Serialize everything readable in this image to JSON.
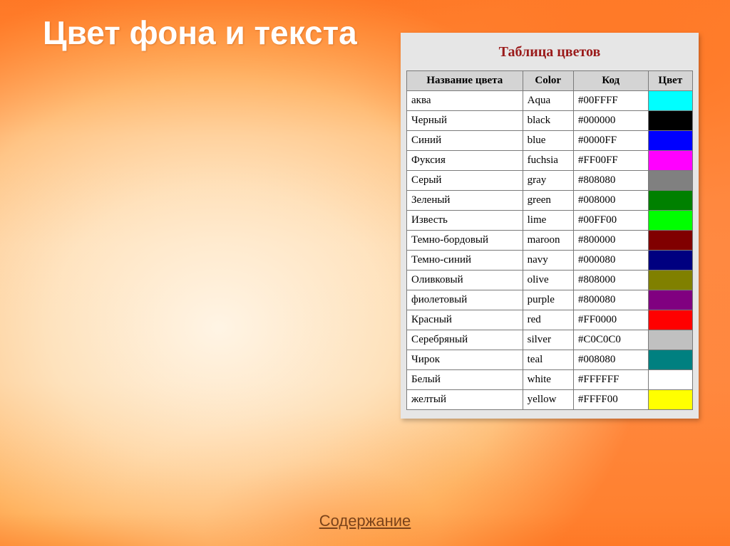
{
  "slide": {
    "title": "Цвет фона и текста"
  },
  "panel": {
    "caption": "Таблица цветов",
    "columns": {
      "name": "Название цвета",
      "en": "Color",
      "code": "Код",
      "swatch": "Цвет"
    },
    "rows": [
      {
        "name": "аква",
        "en": "Aqua",
        "code": "#00FFFF",
        "hex": "#00FFFF"
      },
      {
        "name": "Черный",
        "en": "black",
        "code": "#000000",
        "hex": "#000000"
      },
      {
        "name": "Синий",
        "en": "blue",
        "code": "#0000FF",
        "hex": "#0000FF"
      },
      {
        "name": "Фуксия",
        "en": "fuchsia",
        "code": "#FF00FF",
        "hex": "#FF00FF"
      },
      {
        "name": "Серый",
        "en": "gray",
        "code": "#808080",
        "hex": "#808080"
      },
      {
        "name": "Зеленый",
        "en": "green",
        "code": "#008000",
        "hex": "#008000"
      },
      {
        "name": "Известь",
        "en": "lime",
        "code": "#00FF00",
        "hex": "#00FF00"
      },
      {
        "name": "Темно-бордовый",
        "en": "maroon",
        "code": "#800000",
        "hex": "#800000"
      },
      {
        "name": "Темно-синий",
        "en": "navy",
        "code": "#000080",
        "hex": "#000080"
      },
      {
        "name": "Оливковый",
        "en": "olive",
        "code": "#808000",
        "hex": "#808000"
      },
      {
        "name": "фиолетовый",
        "en": "purple",
        "code": "#800080",
        "hex": "#800080"
      },
      {
        "name": "Красный",
        "en": "red",
        "code": "#FF0000",
        "hex": "#FF0000"
      },
      {
        "name": "Серебряный",
        "en": "silver",
        "code": "#C0C0C0",
        "hex": "#C0C0C0"
      },
      {
        "name": "Чирок",
        "en": "teal",
        "code": "#008080",
        "hex": "#008080"
      },
      {
        "name": "Белый",
        "en": "white",
        "code": "#FFFFFF",
        "hex": "#FFFFFF"
      },
      {
        "name": "желтый",
        "en": "yellow",
        "code": "#FFFF00",
        "hex": "#FFFF00"
      }
    ]
  },
  "footer": {
    "link_label": "Содержание"
  },
  "chart_data": {
    "type": "table",
    "title": "Таблица цветов",
    "columns": [
      "Название цвета",
      "Color",
      "Код",
      "Цвет"
    ],
    "rows": [
      [
        "аква",
        "Aqua",
        "#00FFFF",
        "#00FFFF"
      ],
      [
        "Черный",
        "black",
        "#000000",
        "#000000"
      ],
      [
        "Синий",
        "blue",
        "#0000FF",
        "#0000FF"
      ],
      [
        "Фуксия",
        "fuchsia",
        "#FF00FF",
        "#FF00FF"
      ],
      [
        "Серый",
        "gray",
        "#808080",
        "#808080"
      ],
      [
        "Зеленый",
        "green",
        "#008000",
        "#008000"
      ],
      [
        "Известь",
        "lime",
        "#00FF00",
        "#00FF00"
      ],
      [
        "Темно-бордовый",
        "maroon",
        "#800000",
        "#800000"
      ],
      [
        "Темно-синий",
        "navy",
        "#000080",
        "#000080"
      ],
      [
        "Оливковый",
        "olive",
        "#808000",
        "#808000"
      ],
      [
        "фиолетовый",
        "purple",
        "#800080",
        "#800080"
      ],
      [
        "Красный",
        "red",
        "#FF0000",
        "#FF0000"
      ],
      [
        "Серебряный",
        "silver",
        "#C0C0C0",
        "#C0C0C0"
      ],
      [
        "Чирок",
        "teal",
        "#008080",
        "#008080"
      ],
      [
        "Белый",
        "white",
        "#FFFFFF",
        "#FFFFFF"
      ],
      [
        "желтый",
        "yellow",
        "#FFFF00",
        "#FFFF00"
      ]
    ]
  }
}
